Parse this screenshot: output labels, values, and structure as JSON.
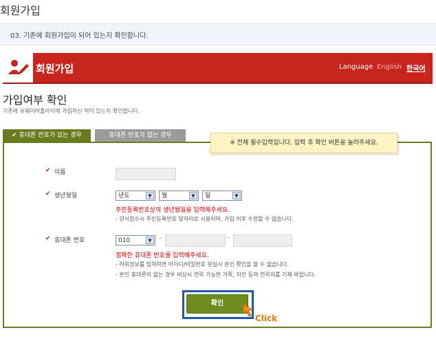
{
  "page": {
    "title": "회원가입",
    "step_text": "03. 기존에 회원가입이 되어 있는지 확인합니다."
  },
  "header": {
    "title": "회원가입",
    "language_label": "Language",
    "english": "English",
    "korean": "한국어",
    "brand_color": "#c8251f"
  },
  "section": {
    "title": "가입여부 확인",
    "description": "기존에 유웨이어플라이에 가입하신 적이 있는지 확인합니다."
  },
  "tabs": [
    {
      "label": "휴대폰 번호가 있는 경우",
      "active": true
    },
    {
      "label": "휴대폰 번호가 없는 경우",
      "active": false
    }
  ],
  "notice": "※ 전체 필수입력입니다. 입력 후 확인 버튼을 눌러주세요.",
  "form": {
    "name_label": "이름",
    "birth_label": "생년월일",
    "birth_year": "년도",
    "birth_month": "월",
    "birth_day": "일",
    "birth_red_note": "주민등록번호상의 생년월일을 입력해주세요.",
    "birth_gray_note": "- 원서접수시 주민등록번호 앞자리로 사용되며, 가입 이후 수정할 수 없습니다.",
    "phone_label": "휴대폰 번호",
    "phone_prefix": "010",
    "dash": "-",
    "phone_red_note": "정확한 휴대폰 번호를 입력해주세요.",
    "phone_note1": "- 허위정보를 입력하면 아이디/비밀번호 분실시 본인 확인을 할 수 없습니다.",
    "phone_note2": "- 본인 휴대폰이 없는 경우 비상시 연락 가능한 가족, 지인 등의 연락처를 기재 바랍니다."
  },
  "confirm_button": "확인",
  "click_hint": "Click",
  "colors": {
    "accent_green": "#6a7a1e",
    "highlight_blue": "#1f5aa8",
    "click_orange": "#e07a00"
  }
}
